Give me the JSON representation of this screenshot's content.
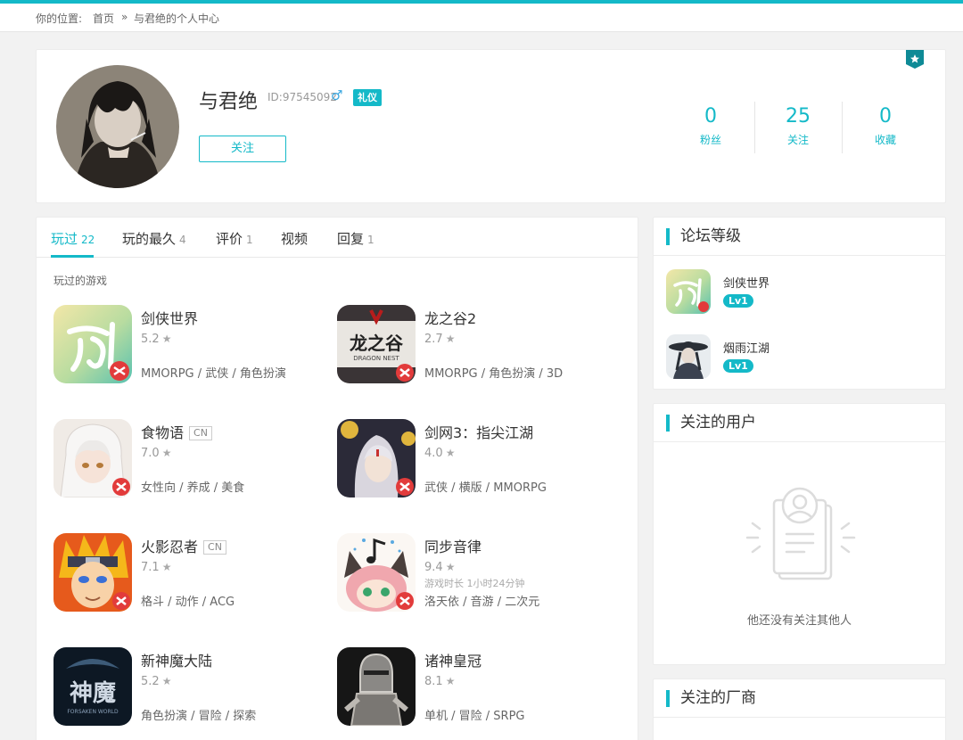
{
  "breadcrumb": {
    "prefix": "你的位置:",
    "home": "首页",
    "sep": "»",
    "current": "与君绝的个人中心"
  },
  "profile": {
    "name": "与君绝",
    "id_text": "ID:97545092",
    "gender_symbol": "♂",
    "badge": "礼仪",
    "follow_button": "关注",
    "stats": [
      {
        "value": "0",
        "label": "粉丝"
      },
      {
        "value": "25",
        "label": "关注"
      },
      {
        "value": "0",
        "label": "收藏"
      }
    ]
  },
  "tabs": [
    {
      "label": "玩过",
      "count": "22",
      "active": true
    },
    {
      "label": "玩的最久",
      "count": "4"
    },
    {
      "label": "评价",
      "count": "1"
    },
    {
      "label": "视频",
      "count": ""
    },
    {
      "label": "回复",
      "count": "1"
    }
  ],
  "section_title": "玩过的游戏",
  "games": [
    {
      "name": "剑侠世界",
      "cn": "",
      "rating": "5.2",
      "extra": "",
      "tags": "MMORPG / 武侠 / 角色扮演"
    },
    {
      "name": "龙之谷2",
      "cn": "",
      "rating": "2.7",
      "extra": "",
      "tags": "MMORPG / 角色扮演 / 3D"
    },
    {
      "name": "食物语",
      "cn": "CN",
      "rating": "7.0",
      "extra": "",
      "tags": "女性向 / 养成 / 美食"
    },
    {
      "name": "剑网3：指尖江湖",
      "cn": "",
      "rating": "4.0",
      "extra": "",
      "tags": "武侠 / 横版 / MMORPG"
    },
    {
      "name": "火影忍者",
      "cn": "CN",
      "rating": "7.1",
      "extra": "",
      "tags": "格斗 / 动作 / ACG"
    },
    {
      "name": "同步音律",
      "cn": "",
      "rating": "9.4",
      "extra": "游戏时长 1小时24分钟",
      "tags": "洛天依 / 音游 / 二次元"
    },
    {
      "name": "新神魔大陆",
      "cn": "",
      "rating": "5.2",
      "extra": "",
      "tags": "角色扮演 / 冒险 / 探索"
    },
    {
      "name": "诸神皇冠",
      "cn": "",
      "rating": "8.1",
      "extra": "",
      "tags": "单机 / 冒险 / SRPG"
    }
  ],
  "icon_text": {
    "lzg_main": "龙之谷",
    "lzg_sub": "DRAGON NEST",
    "sm_main": "神魔",
    "sm_sub": "FORSAKEN WORLD"
  },
  "rating_star": "★",
  "forum_level": {
    "title": "论坛等级",
    "items": [
      {
        "name": "剑侠世界",
        "level": "Lv1"
      },
      {
        "name": "烟雨江湖",
        "level": "Lv1"
      }
    ]
  },
  "followed_users": {
    "title": "关注的用户",
    "empty_text": "他还没有关注其他人"
  },
  "followed_vendors": {
    "title": "关注的厂商"
  },
  "colors": {
    "accent": "#14b9c8",
    "background": "#f2f2f2"
  }
}
